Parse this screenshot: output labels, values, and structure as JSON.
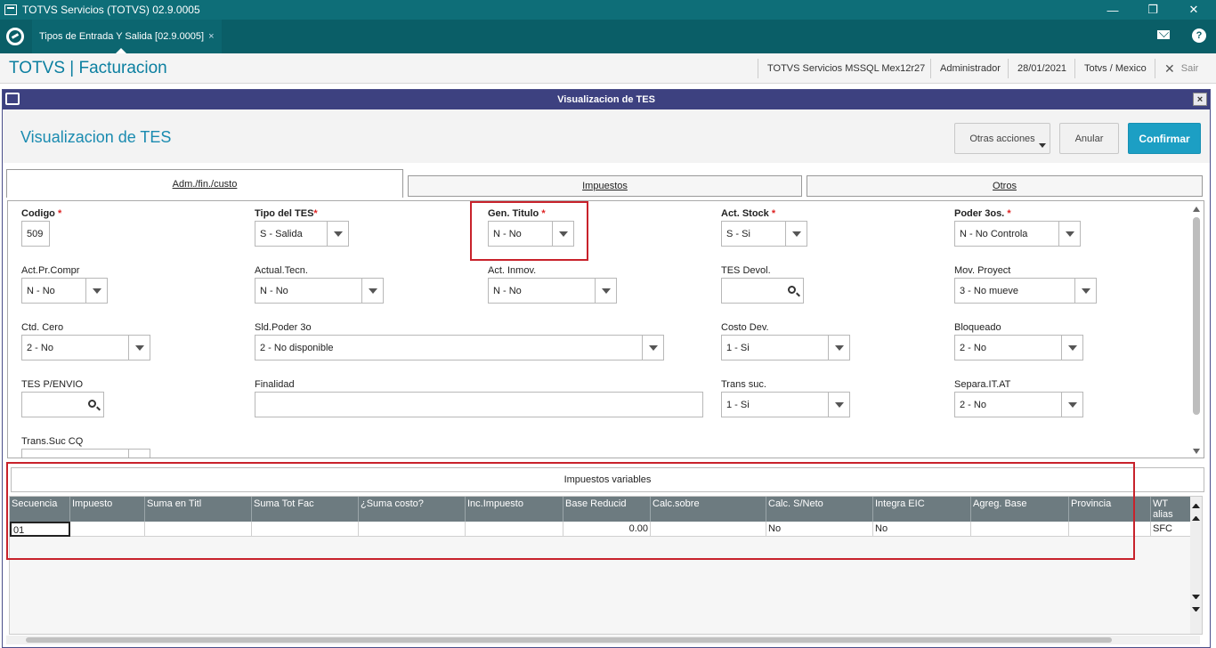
{
  "window": {
    "title": "TOTVS Servicios (TOTVS) 02.9.0005",
    "minimize": "—",
    "restore": "❐",
    "close": "✕"
  },
  "tabbar": {
    "active_tab": "Tipos de Entrada Y Salida [02.9.0005]",
    "tab_close": "×",
    "help": "?"
  },
  "header": {
    "app_title": "TOTVS | Facturacion",
    "environment": "TOTVS Servicios MSSQL Mex12r27",
    "user": "Administrador",
    "date": "28/01/2021",
    "company": "Totvs / Mexico",
    "exit_label": "Sair",
    "exit_icon": "✕"
  },
  "modal": {
    "title": "Visualizacion de TES",
    "close": "×",
    "page_title": "Visualizacion de TES",
    "buttons": {
      "other_actions": "Otras acciones",
      "cancel": "Anular",
      "confirm": "Confirmar"
    }
  },
  "tabs": [
    "Adm./fin./custo",
    "Impuestos",
    "Otros"
  ],
  "form": {
    "codigo": {
      "label": "Codigo",
      "value": "509"
    },
    "tipo_tes": {
      "label": "Tipo del TES",
      "value": "S - Salida"
    },
    "gen_titulo": {
      "label": "Gen. Titulo",
      "value": "N - No"
    },
    "act_stock": {
      "label": "Act. Stock",
      "value": "S - Si"
    },
    "poder_3os": {
      "label": "Poder 3os.",
      "value": "N - No Controla"
    },
    "act_pr_compr": {
      "label": "Act.Pr.Compr",
      "value": "N - No"
    },
    "actual_tecn": {
      "label": "Actual.Tecn.",
      "value": "N - No"
    },
    "act_inmov": {
      "label": "Act. Inmov.",
      "value": "N - No"
    },
    "tes_devol": {
      "label": "TES Devol.",
      "value": ""
    },
    "mov_proyect": {
      "label": "Mov. Proyect",
      "value": "3 - No mueve"
    },
    "ctd_cero": {
      "label": "Ctd. Cero",
      "value": "2 - No"
    },
    "sld_poder_3o": {
      "label": "Sld.Poder 3o",
      "value": "2 - No disponible"
    },
    "costo_dev": {
      "label": "Costo Dev.",
      "value": "1 - Si"
    },
    "bloqueado": {
      "label": "Bloqueado",
      "value": "2 - No"
    },
    "tes_penvio": {
      "label": "TES P/ENVIO",
      "value": ""
    },
    "finalidad": {
      "label": "Finalidad",
      "value": ""
    },
    "trans_suc": {
      "label": "Trans suc.",
      "value": "1 - Si"
    },
    "separa_it_at": {
      "label": "Separa.IT.AT",
      "value": "2 - No"
    },
    "trans_suc_cq": {
      "label": "Trans.Suc CQ",
      "value": ""
    }
  },
  "impuestos_variables": {
    "title": "Impuestos variables",
    "columns": [
      "Secuencia",
      "Impuesto",
      "Suma en Titl",
      "Suma Tot Fac",
      "¿Suma costo?",
      "Inc.Impuesto",
      "Base Reducid",
      "Calc.sobre",
      "Calc. S/Neto",
      "Integra EIC",
      "Agreg. Base",
      "Provincia",
      "WT alias"
    ],
    "rows": [
      [
        "01",
        "",
        "",
        "",
        "",
        "",
        "0.00",
        "",
        "No",
        "No",
        "",
        "",
        "SFC"
      ]
    ]
  }
}
